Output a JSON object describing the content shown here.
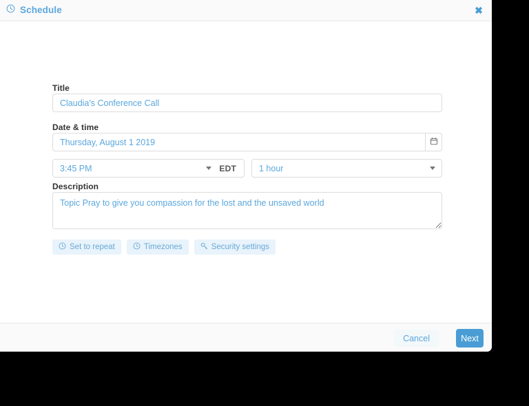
{
  "header": {
    "icon": "clock-icon",
    "title": "Schedule",
    "close_label": "✖"
  },
  "form": {
    "title": {
      "label": "Title",
      "value": "Claudia's Conference Call",
      "placeholder": "Title"
    },
    "datetime": {
      "label": "Date & time",
      "date_value": "Thursday, August 1 2019",
      "date_placeholder": "Date",
      "calendar_icon": "calendar-icon",
      "time_value": "3:45 PM",
      "timezone": "EDT",
      "duration_value": "1 hour"
    },
    "description": {
      "label": "Description",
      "value": "Topic Pray to give you compassion for the lost and the unsaved world",
      "placeholder": "Description"
    },
    "chips": [
      {
        "icon": "clock-icon",
        "label": "Set to repeat"
      },
      {
        "icon": "clock-icon",
        "label": "Timezones"
      },
      {
        "icon": "key-icon",
        "label": "Security settings"
      }
    ]
  },
  "footer": {
    "cancel_label": "Cancel",
    "next_label": "Next"
  },
  "colors": {
    "accent": "#4a9dd4",
    "link_text": "#5ba7dd",
    "chip_bg": "#e8f3fb",
    "border": "#dcdcdc",
    "header_bg": "#fafafa"
  }
}
